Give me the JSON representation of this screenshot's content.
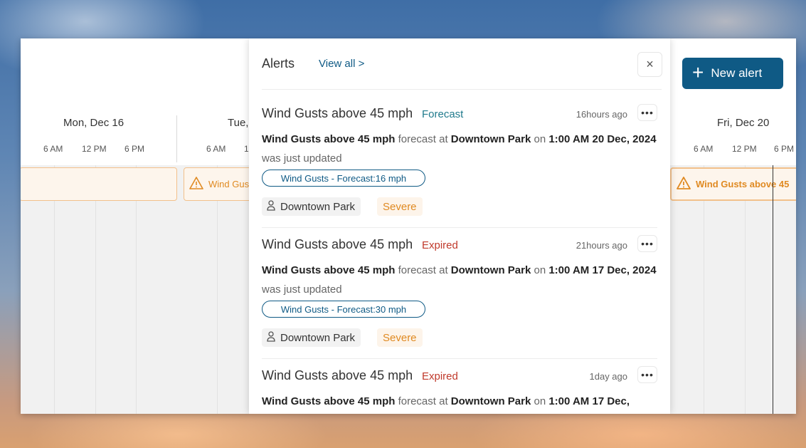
{
  "calendar": {
    "days": [
      {
        "label": "Mon, Dec 16",
        "hours": [
          "6 AM",
          "12 PM",
          "6 PM"
        ]
      },
      {
        "label": "Tue,",
        "hours": [
          "6 AM",
          "1"
        ]
      },
      {
        "label": "Fri, Dec 20",
        "hours": [
          "6 AM",
          "12 PM",
          "6 PM"
        ]
      }
    ],
    "events": [
      "Wind Gus",
      "Wind Gusts above 45"
    ]
  },
  "new_alert_label": "New alert",
  "panel": {
    "title": "Alerts",
    "view_all": "View all >",
    "close": "×",
    "alerts": [
      {
        "title": "Wind Gusts above 45 mph",
        "status": "Forecast",
        "status_color": "#1f7a8c",
        "time": "16hours ago",
        "more": "•••",
        "body": {
          "name": "Wind Gusts above 45 mph",
          "w1": "forecast at",
          "place": "Downtown Park",
          "w2": "on",
          "date": "1:00 AM 20 Dec, 2024",
          "w3": "was just updated"
        },
        "pill": "Wind Gusts - Forecast:16 mph",
        "location": "Downtown Park",
        "severity": "Severe"
      },
      {
        "title": "Wind Gusts above 45 mph",
        "status": "Expired",
        "status_color": "#c0392b",
        "time": "21hours ago",
        "more": "•••",
        "body": {
          "name": "Wind Gusts above 45 mph",
          "w1": "forecast at",
          "place": "Downtown Park",
          "w2": "on",
          "date": "1:00 AM 17 Dec, 2024",
          "w3": "was just updated"
        },
        "pill": "Wind Gusts - Forecast:30 mph",
        "location": "Downtown Park",
        "severity": "Severe"
      },
      {
        "title": "Wind Gusts above 45 mph",
        "status": "Expired",
        "status_color": "#c0392b",
        "time": "1day ago",
        "more": "•••",
        "body": {
          "name": "Wind Gusts above 45 mph",
          "w1": "forecast at",
          "place": "Downtown Park",
          "w2": "on",
          "date": "1:00 AM 17 Dec,"
        }
      }
    ]
  }
}
